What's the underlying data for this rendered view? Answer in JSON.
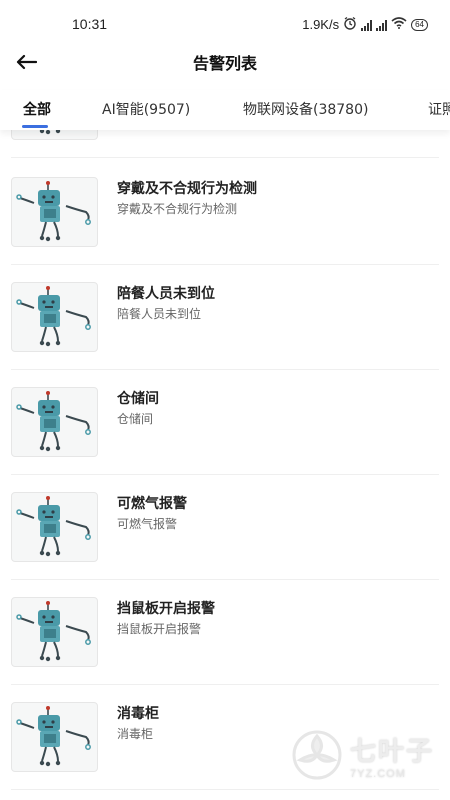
{
  "status_bar": {
    "time": "10:31",
    "speed": "1.9K/s",
    "battery": "64"
  },
  "header": {
    "title": "告警列表",
    "back_icon": "arrow-left-icon"
  },
  "tabs": [
    {
      "label": "全部",
      "active": true
    },
    {
      "label": "AI智能(9507)",
      "active": false
    },
    {
      "label": "物联网设备(38780)",
      "active": false
    },
    {
      "label": "证照",
      "active": false
    }
  ],
  "items": [
    {
      "title": "穿戴及不合规行为检测",
      "subtitle": "穿戴及不合规行为检测",
      "icon": "robot-icon"
    },
    {
      "title": "陪餐人员未到位",
      "subtitle": "陪餐人员未到位",
      "icon": "robot-icon"
    },
    {
      "title": "仓储间",
      "subtitle": "仓储间",
      "icon": "robot-icon"
    },
    {
      "title": "可燃气报警",
      "subtitle": "可燃气报警",
      "icon": "robot-icon"
    },
    {
      "title": "挡鼠板开启报警",
      "subtitle": "挡鼠板开启报警",
      "icon": "robot-icon"
    },
    {
      "title": "消毒柜",
      "subtitle": "消毒柜",
      "icon": "robot-icon"
    }
  ],
  "watermark": {
    "cn": "七叶子",
    "en": "7YZ.COM"
  },
  "colors": {
    "accent": "#3b6fe0",
    "robot_body": "#4a9aa8",
    "robot_dark": "#2f3e46"
  }
}
